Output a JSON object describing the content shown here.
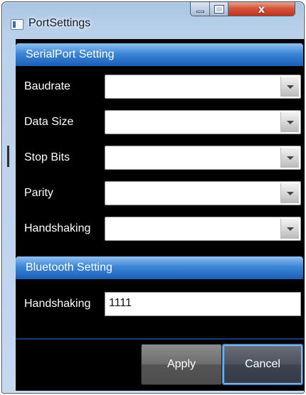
{
  "window": {
    "title": "PortSettings",
    "close_glyph": "x"
  },
  "serial_section": {
    "header": "SerialPort Setting",
    "rows": [
      {
        "label": "Baudrate",
        "value": ""
      },
      {
        "label": "Data Size",
        "value": ""
      },
      {
        "label": "Stop Bits",
        "value": ""
      },
      {
        "label": "Parity",
        "value": ""
      },
      {
        "label": "Handshaking",
        "value": ""
      }
    ]
  },
  "bluetooth_section": {
    "header": "Bluetooth Setting",
    "handshaking_label": "Handshaking",
    "handshaking_value": "1111"
  },
  "buttons": {
    "apply": "Apply",
    "cancel": "Cancel"
  },
  "colors": {
    "section_header": "#2f78d0",
    "client_background": "#000000",
    "focus_border": "#4d8fd3"
  }
}
